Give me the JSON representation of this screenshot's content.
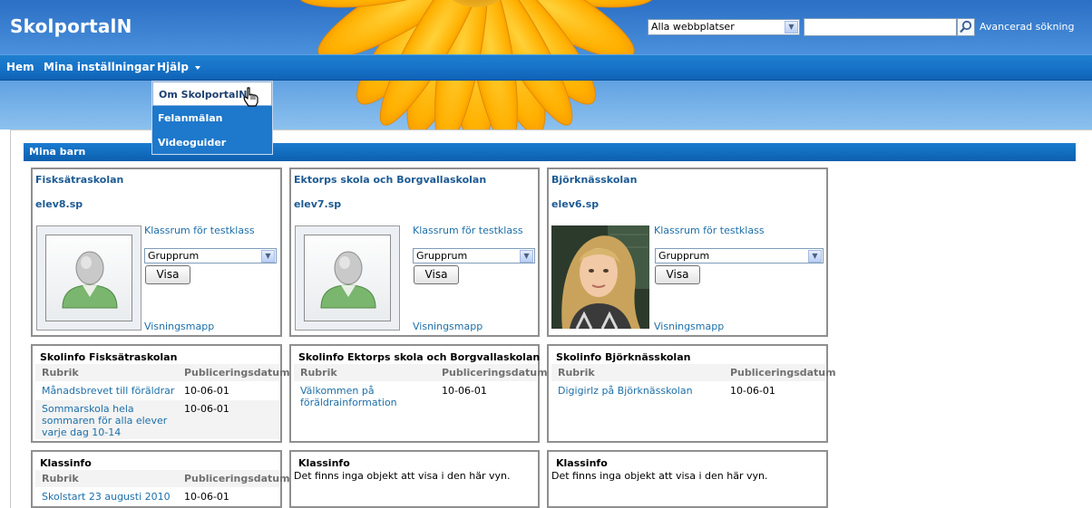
{
  "header": {
    "site_title": "SkolportalN",
    "scope_select_value": "Alla webbplatser",
    "search_placeholder": "",
    "advanced_search": "Avancerad sökning"
  },
  "nav": {
    "items": [
      "Hem",
      "Mina inställningar",
      "Hjälp"
    ]
  },
  "help_menu": {
    "items": [
      "Om SkolportalN",
      "Felanmälan",
      "Videoguider"
    ]
  },
  "section_title": "Mina barn",
  "children": [
    {
      "school": "Fisksätraskolan",
      "user": "elev8.sp",
      "class_link": "Klassrum för testklass",
      "room_select": "Grupprum",
      "show_button": "Visa",
      "view_link": "Visningsmapp",
      "avatar": "default-avatar"
    },
    {
      "school": "Ektorps skola och Borgvallaskolan",
      "user": "elev7.sp",
      "class_link": "Klassrum för testklass",
      "room_select": "Grupprum",
      "show_button": "Visa",
      "view_link": "Visningsmapp",
      "avatar": "default-avatar"
    },
    {
      "school": "Björknässkolan",
      "user": "elev6.sp",
      "class_link": "Klassrum för testklass",
      "room_select": "Grupprum",
      "show_button": "Visa",
      "view_link": "Visningsmapp",
      "avatar": "student-photo"
    }
  ],
  "school_info": [
    {
      "title": "Skolinfo Fisksätraskolan",
      "col_rubrik": "Rubrik",
      "col_date": "Publiceringsdatum",
      "rows": [
        {
          "rubrik": "Månadsbrevet till föräldrar",
          "date": "10-06-01"
        },
        {
          "rubrik": "Sommarskola hela sommaren för alla elever varje dag 10-14",
          "date": "10-06-01"
        }
      ]
    },
    {
      "title": "Skolinfo Ektorps skola och Borgvallaskolan",
      "col_rubrik": "Rubrik",
      "col_date": "Publiceringsdatum",
      "rows": [
        {
          "rubrik": "Välkommen på föräldrainformation",
          "date": "10-06-01"
        }
      ]
    },
    {
      "title": "Skolinfo Björknässkolan",
      "col_rubrik": "Rubrik",
      "col_date": "Publiceringsdatum",
      "rows": [
        {
          "rubrik": "Digigirlz på Björknässkolan",
          "date": "10-06-01"
        }
      ]
    }
  ],
  "class_info": [
    {
      "title": "Klassinfo",
      "col_rubrik": "Rubrik",
      "col_date": "Publiceringsdatum",
      "rows": [
        {
          "rubrik": "Skolstart 23 augusti 2010",
          "date": "10-06-01"
        }
      ]
    },
    {
      "title": "Klassinfo",
      "empty": "Det finns inga objekt att visa i den här vyn."
    },
    {
      "title": "Klassinfo",
      "empty": "Det finns inga objekt att visa i den här vyn."
    }
  ],
  "colors": {
    "nav_blue": "#1672c7",
    "link_blue": "#1c6fa8",
    "panel_border": "#8f8f8f"
  }
}
